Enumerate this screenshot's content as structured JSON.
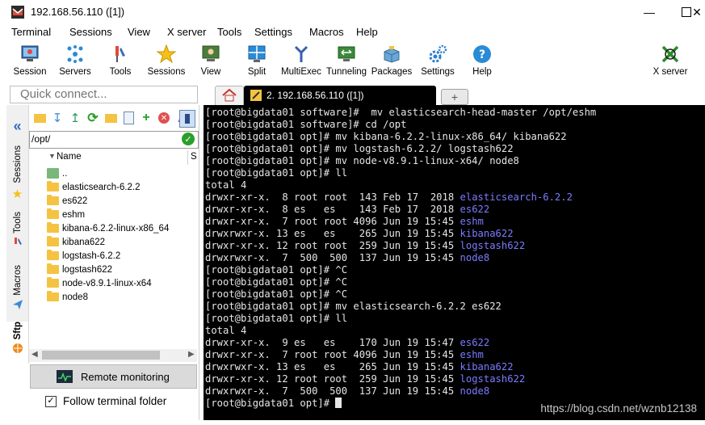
{
  "window": {
    "title": "192.168.56.110 ([1])"
  },
  "menu": [
    "Terminal",
    "Sessions",
    "View",
    "X server",
    "Tools",
    "Settings",
    "Macros",
    "Help"
  ],
  "toolbar": [
    {
      "label": "Session",
      "icon": "session-icon"
    },
    {
      "label": "Servers",
      "icon": "servers-icon"
    },
    {
      "label": "Tools",
      "icon": "tools-icon"
    },
    {
      "label": "Sessions",
      "icon": "star-icon"
    },
    {
      "label": "View",
      "icon": "view-icon"
    },
    {
      "label": "Split",
      "icon": "split-icon"
    },
    {
      "label": "MultiExec",
      "icon": "multiexec-icon"
    },
    {
      "label": "Tunneling",
      "icon": "tunneling-icon"
    },
    {
      "label": "Packages",
      "icon": "packages-icon"
    },
    {
      "label": "Settings",
      "icon": "gears-icon"
    },
    {
      "label": "Help",
      "icon": "help-icon"
    },
    {
      "label": "X server",
      "icon": "xserver-icon"
    }
  ],
  "quick_connect": {
    "placeholder": "Quick connect..."
  },
  "tabs": {
    "session_label": "2. 192.168.56.110 ([1])"
  },
  "side_tabs": [
    "Sessions",
    "Tools",
    "Macros",
    "Sftp"
  ],
  "sftp": {
    "path": "/opt/",
    "column_name": "Name",
    "column_size": "S",
    "files": [
      "..",
      "elasticsearch-6.2.2",
      "es622",
      "eshm",
      "kibana-6.2.2-linux-x86_64",
      "kibana622",
      "logstash-6.2.2",
      "logstash622",
      "node-v8.9.1-linux-x64",
      "node8"
    ],
    "remote_monitoring": "Remote monitoring",
    "follow_folder": "Follow terminal folder"
  },
  "terminal": {
    "lines": [
      {
        "text": "[root@bigdata01 software]#  mv elasticsearch-head-master /opt/eshm"
      },
      {
        "text": "[root@bigdata01 software]# cd /opt"
      },
      {
        "text": "[root@bigdata01 opt]# mv kibana-6.2.2-linux-x86_64/ kibana622"
      },
      {
        "text": "[root@bigdata01 opt]# mv logstash-6.2.2/ logstash622"
      },
      {
        "text": "[root@bigdata01 opt]# mv node-v8.9.1-linux-x64/ node8"
      },
      {
        "text": "[root@bigdata01 opt]# ll"
      },
      {
        "text": "total 4"
      },
      {
        "text": "drwxr-xr-x.  8 root root  143 Feb 17  2018 ",
        "name": "elasticsearch-6.2.2"
      },
      {
        "text": "drwxr-xr-x.  8 es   es    143 Feb 17  2018 ",
        "name": "es622"
      },
      {
        "text": "drwxr-xr-x.  7 root root 4096 Jun 19 15:45 ",
        "name": "eshm"
      },
      {
        "text": "drwxrwxr-x. 13 es   es    265 Jun 19 15:45 ",
        "name": "kibana622"
      },
      {
        "text": "drwxr-xr-x. 12 root root  259 Jun 19 15:45 ",
        "name": "logstash622"
      },
      {
        "text": "drwxrwxr-x.  7  500  500  137 Jun 19 15:45 ",
        "name": "node8"
      },
      {
        "text": "[root@bigdata01 opt]# ^C"
      },
      {
        "text": "[root@bigdata01 opt]# ^C"
      },
      {
        "text": "[root@bigdata01 opt]# ^C"
      },
      {
        "text": "[root@bigdata01 opt]# mv elasticsearch-6.2.2 es622"
      },
      {
        "text": "[root@bigdata01 opt]# ll"
      },
      {
        "text": "total 4"
      },
      {
        "text": "drwxr-xr-x.  9 es   es    170 Jun 19 15:47 ",
        "name": "es622"
      },
      {
        "text": "drwxr-xr-x.  7 root root 4096 Jun 19 15:45 ",
        "name": "eshm"
      },
      {
        "text": "drwxrwxr-x. 13 es   es    265 Jun 19 15:45 ",
        "name": "kibana622"
      },
      {
        "text": "drwxr-xr-x. 12 root root  259 Jun 19 15:45 ",
        "name": "logstash622"
      },
      {
        "text": "drwxrwxr-x.  7  500  500  137 Jun 19 15:45 ",
        "name": "node8"
      }
    ],
    "prompt": "[root@bigdata01 opt]# "
  },
  "watermark": "https://blog.csdn.net/wznb12138",
  "colors": {
    "dir_blue": "#7b7bff",
    "terminal_bg": "#000000",
    "folder": "#f5c342"
  }
}
